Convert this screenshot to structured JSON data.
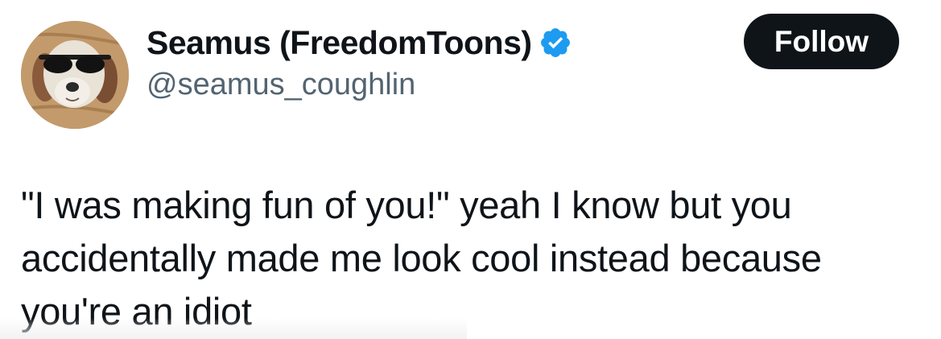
{
  "author": {
    "display_name": "Seamus (FreedomToons)",
    "handle": "@seamus_coughlin",
    "verified": true,
    "avatar_icon": "dog-with-sunglasses-avatar"
  },
  "follow_button": {
    "label": "Follow"
  },
  "tweet": {
    "text": "\"I was making fun of you!\" yeah I know but you accidentally made me look cool instead because you're an idiot"
  },
  "colors": {
    "button_bg": "#0f1419",
    "button_text": "#ffffff",
    "handle": "#536471",
    "verified_badge": "#1d9bf0"
  }
}
